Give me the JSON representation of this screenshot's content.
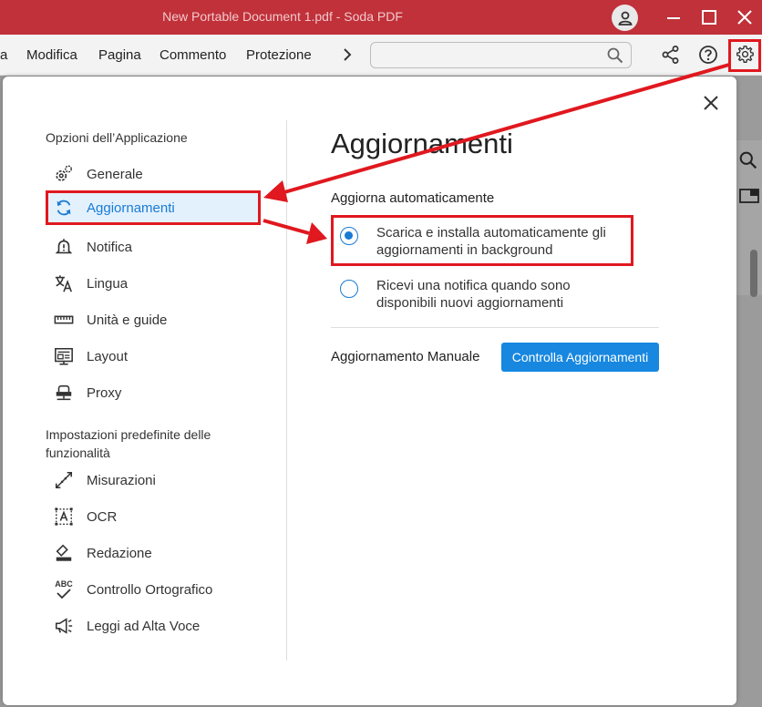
{
  "window": {
    "title": "New Portable Document 1.pdf  -  Soda PDF",
    "icons": {
      "user": "user-icon",
      "minimize": "minimize-icon",
      "maximize": "maximize-icon",
      "close": "close-icon"
    }
  },
  "menubar": {
    "items": [
      "a",
      "Modifica",
      "Pagina",
      "Commento",
      "Protezione"
    ],
    "search_placeholder": "",
    "icons": {
      "next": "chevron-right-icon",
      "search": "search-icon",
      "share": "share-icon",
      "help": "help-icon",
      "settings": "gear-icon"
    }
  },
  "dialog": {
    "sidebar": {
      "section1_label": "Opzioni dell’Applicazione",
      "section1_items": [
        {
          "label": "Generale",
          "icon": "gears-icon"
        },
        {
          "label": "Aggiornamenti",
          "icon": "sync-icon",
          "active": true
        },
        {
          "label": "Notifica",
          "icon": "bell-icon"
        },
        {
          "label": "Lingua",
          "icon": "translate-icon"
        },
        {
          "label": "Unità e guide",
          "icon": "ruler-icon"
        },
        {
          "label": "Layout",
          "icon": "layout-icon"
        },
        {
          "label": "Proxy",
          "icon": "proxy-icon"
        }
      ],
      "section2_label": "Impostazioni predefinite delle funzionalità",
      "section2_items": [
        {
          "label": "Misurazioni",
          "icon": "measure-icon"
        },
        {
          "label": "OCR",
          "icon": "ocr-icon"
        },
        {
          "label": "Redazione",
          "icon": "eraser-icon"
        },
        {
          "label": "Controllo Ortografico",
          "icon": "spellcheck-icon"
        },
        {
          "label": "Leggi ad Alta Voce",
          "icon": "megaphone-icon"
        }
      ],
      "abc_glyph": "ABC"
    },
    "content": {
      "title": "Aggiornamenti",
      "auto_label": "Aggiorna automaticamente",
      "options": [
        {
          "label": "Scarica e installa automaticamente gli aggiornamenti in background",
          "checked": true
        },
        {
          "label": "Ricevi una notifica quando sono disponibili nuovi aggiornamenti",
          "checked": false
        }
      ],
      "manual_label": "Aggiornamento Manuale",
      "check_button": "Controlla Aggiornamenti"
    }
  },
  "colors": {
    "accent": "#1a7bd4",
    "titlebar": "#c0313a",
    "annotation": "#e0181f",
    "button": "#1787e0"
  }
}
